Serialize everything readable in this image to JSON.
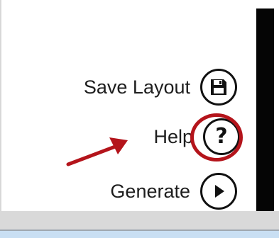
{
  "menu": {
    "save_label": "Save Layout",
    "help_label": "Help",
    "generate_label": "Generate",
    "help_glyph": "?"
  },
  "icons": {
    "save": "floppy-disk-icon",
    "help": "question-mark-icon",
    "generate": "play-icon"
  },
  "colors": {
    "annotation": "#b4141b",
    "icon_stroke": "#111111",
    "dark_bar": "#050505",
    "bottom_strip": "#c9dff3"
  }
}
